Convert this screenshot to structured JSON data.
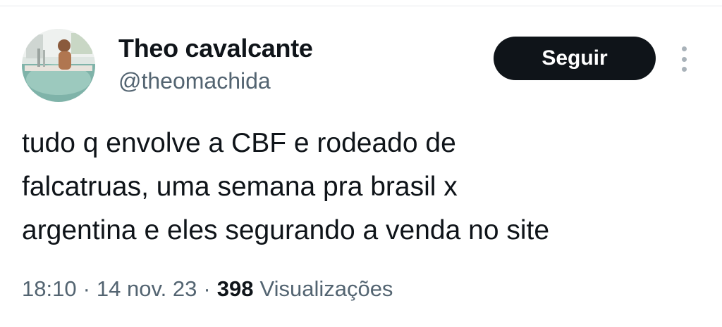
{
  "author": {
    "display_name": "Theo cavalcante",
    "handle": "@theomachida",
    "avatar_description": "avatar"
  },
  "actions": {
    "follow_label": "Seguir",
    "more_icon": "more-vertical-icon"
  },
  "tweet": {
    "lines": [
      "tudo q envolve a CBF e rodeado de",
      "falcatruas, uma semana pra brasil x",
      "argentina e eles segurando a venda no site"
    ]
  },
  "meta": {
    "time": "18:10",
    "separator": "·",
    "date": "14 nov. 23",
    "views_count": "398",
    "views_label": "Visualizações"
  },
  "colors": {
    "text_primary": "#0f1419",
    "text_secondary": "#536471",
    "button_bg": "#0f1419",
    "button_text": "#ffffff"
  }
}
